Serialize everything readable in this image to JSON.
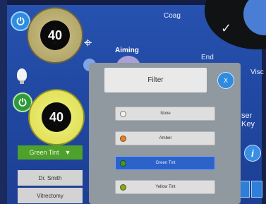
{
  "left_panel": {
    "aiming_dial_value": "40",
    "power_dial_value": "40",
    "green_tint_label": "Green Tint",
    "green_tint_caret": "▼",
    "doctor_label": "Dr. Smith",
    "procedure_label": "Vitrectomy"
  },
  "labels": {
    "coag": "Coag",
    "aiming": "Aiming",
    "end": "End",
    "visc": "Visc",
    "user_keys": "ser Key"
  },
  "icons": {
    "power": "⏻",
    "crosshair": "⌖",
    "check": "✓",
    "info": "i"
  },
  "filter_dialog": {
    "title": "Filter",
    "close_label": "X",
    "options": [
      {
        "label": "None",
        "dot_color": "#f2f2f2"
      },
      {
        "label": "Amber",
        "dot_color": "#e8821e"
      },
      {
        "label": "Green Tint",
        "dot_color": "#3f9a2a",
        "selected": true
      },
      {
        "label": "Yellow Tint",
        "dot_color": "#8aa61e"
      }
    ]
  },
  "colors": {
    "background": "#2149a3",
    "selected_option": "#2d62c9",
    "green_tint_button": "#4ea12b"
  }
}
